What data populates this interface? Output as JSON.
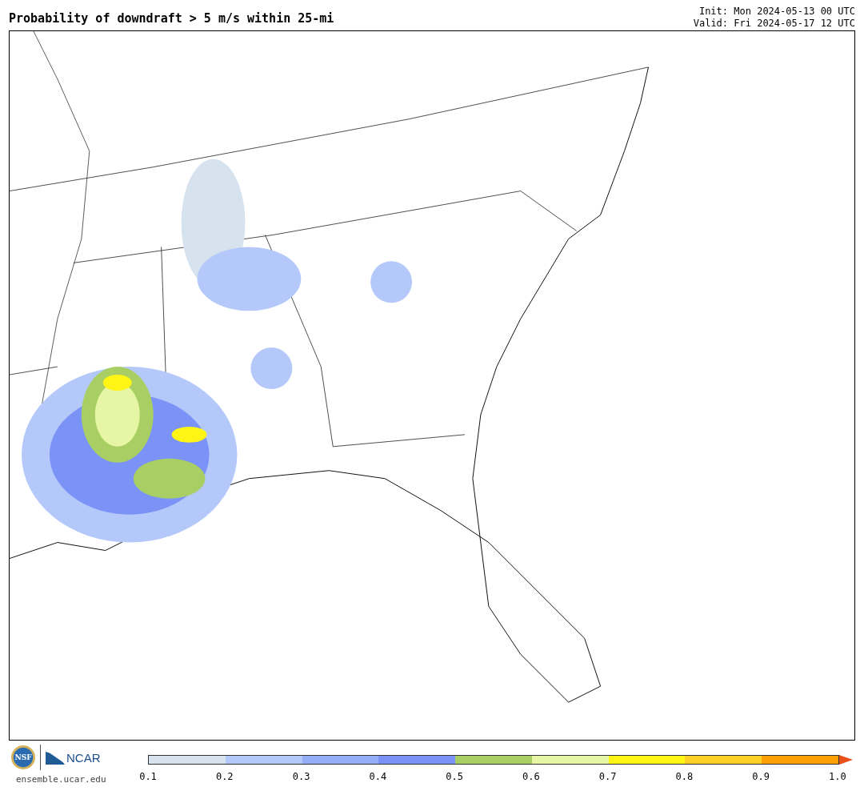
{
  "header": {
    "title": "Probability of downdraft > 5 m/s within 25-mi",
    "init": "Init: Mon 2024-05-13 00 UTC",
    "valid": "Valid: Fri 2024-05-17 12 UTC"
  },
  "footer": {
    "nsf_logo": "NSF",
    "ncar_logo": "NCAR",
    "site": "ensemble.ucar.edu"
  },
  "colorbar": {
    "bins": [
      {
        "color": "#d6e2ee"
      },
      {
        "color": "#b4c8fa"
      },
      {
        "color": "#94aef8"
      },
      {
        "color": "#7b93f6"
      },
      {
        "color": "#a9cf64"
      },
      {
        "color": "#e6f6a4"
      },
      {
        "color": "#fef416"
      },
      {
        "color": "#fdd128"
      },
      {
        "color": "#fd9f07"
      }
    ],
    "ticks": [
      "0.1",
      "0.2",
      "0.3",
      "0.4",
      "0.5",
      "0.6",
      "0.7",
      "0.8",
      "0.9",
      "1.0"
    ]
  }
}
